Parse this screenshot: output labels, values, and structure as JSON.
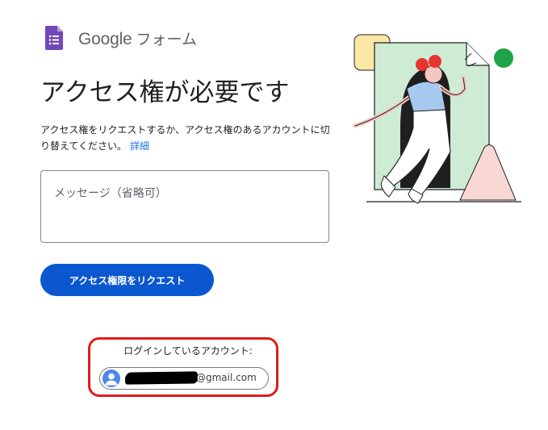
{
  "brand": {
    "google": "Google",
    "product": "フォーム",
    "icon": "google-forms-icon"
  },
  "page": {
    "title": "アクセス権が必要です",
    "description": "アクセス権をリクエストするか、アクセス権のあるアカウントに切り替えてください。",
    "details_link": "詳細"
  },
  "message": {
    "placeholder": "メッセージ（省略可）",
    "value": ""
  },
  "request_button": {
    "label": "アクセス権限をリクエスト"
  },
  "account": {
    "label": "ログインしているアカウント:",
    "email_visible": "@gmail.com",
    "avatar_icon": "user-avatar-icon",
    "redacted": true
  },
  "colors": {
    "primary_button": "#0b57d0",
    "link": "#1a73e8",
    "forms_purple": "#7248b9",
    "highlight_red": "#e01b1b",
    "avatar_blue": "#4f86ec"
  }
}
